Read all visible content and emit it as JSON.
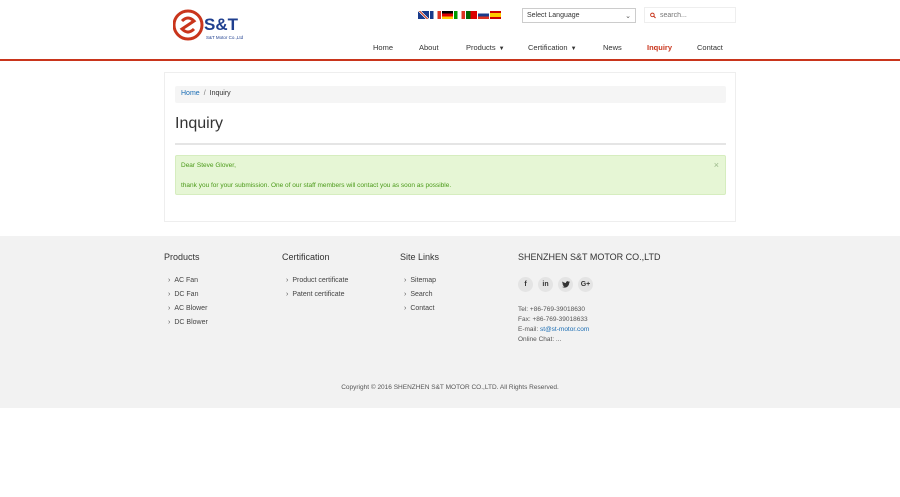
{
  "header": {
    "logo_text": "S&T",
    "logo_subtext": "S&T Motor Co.,Ltd",
    "language_select": "Select Language",
    "search_placeholder": "search...",
    "flags": [
      "english-flag",
      "french-flag",
      "german-flag",
      "italian-flag",
      "portuguese-flag",
      "russian-flag",
      "spanish-flag"
    ]
  },
  "nav": {
    "items": [
      {
        "label": "Home"
      },
      {
        "label": "About"
      },
      {
        "label": "Products"
      },
      {
        "label": "Certification"
      },
      {
        "label": "News"
      },
      {
        "label": "Inquiry"
      },
      {
        "label": "Contact"
      }
    ]
  },
  "breadcrumb": {
    "home": "Home",
    "separator": "/",
    "current": "Inquiry"
  },
  "page": {
    "title": "Inquiry"
  },
  "alert": {
    "greeting": "Dear Steve Glover,",
    "message": "thank you for your submission. One of our staff members will contact you as soon as possible.",
    "close": "×"
  },
  "footer": {
    "products": {
      "title": "Products",
      "items": [
        "AC Fan",
        "DC Fan",
        "AC Blower",
        "DC Blower"
      ]
    },
    "certification": {
      "title": "Certification",
      "items": [
        "Product certificate",
        "Patent certificate"
      ]
    },
    "site_links": {
      "title": "Site Links",
      "items": [
        "Sitemap",
        "Search",
        "Contact"
      ]
    },
    "company": {
      "title": "SHENZHEN S&T MOTOR CO.,LTD",
      "social": [
        "f",
        "in",
        "t",
        "G+"
      ],
      "tel": "Tel: +86-769-39018630",
      "fax": "Fax: +86-769-39018633",
      "email_label": "E-mail: ",
      "email": "st@st-motor.com",
      "chat": "Online Chat: ..."
    },
    "copyright": "Copyright © 2016 SHENZHEN S&T MOTOR CO.,LTD. All Rights Reserved."
  },
  "colors": {
    "accent": "#c9351c",
    "link": "#1a6db4",
    "alert_bg": "#e6f6d5",
    "alert_text": "#4b9a19"
  }
}
